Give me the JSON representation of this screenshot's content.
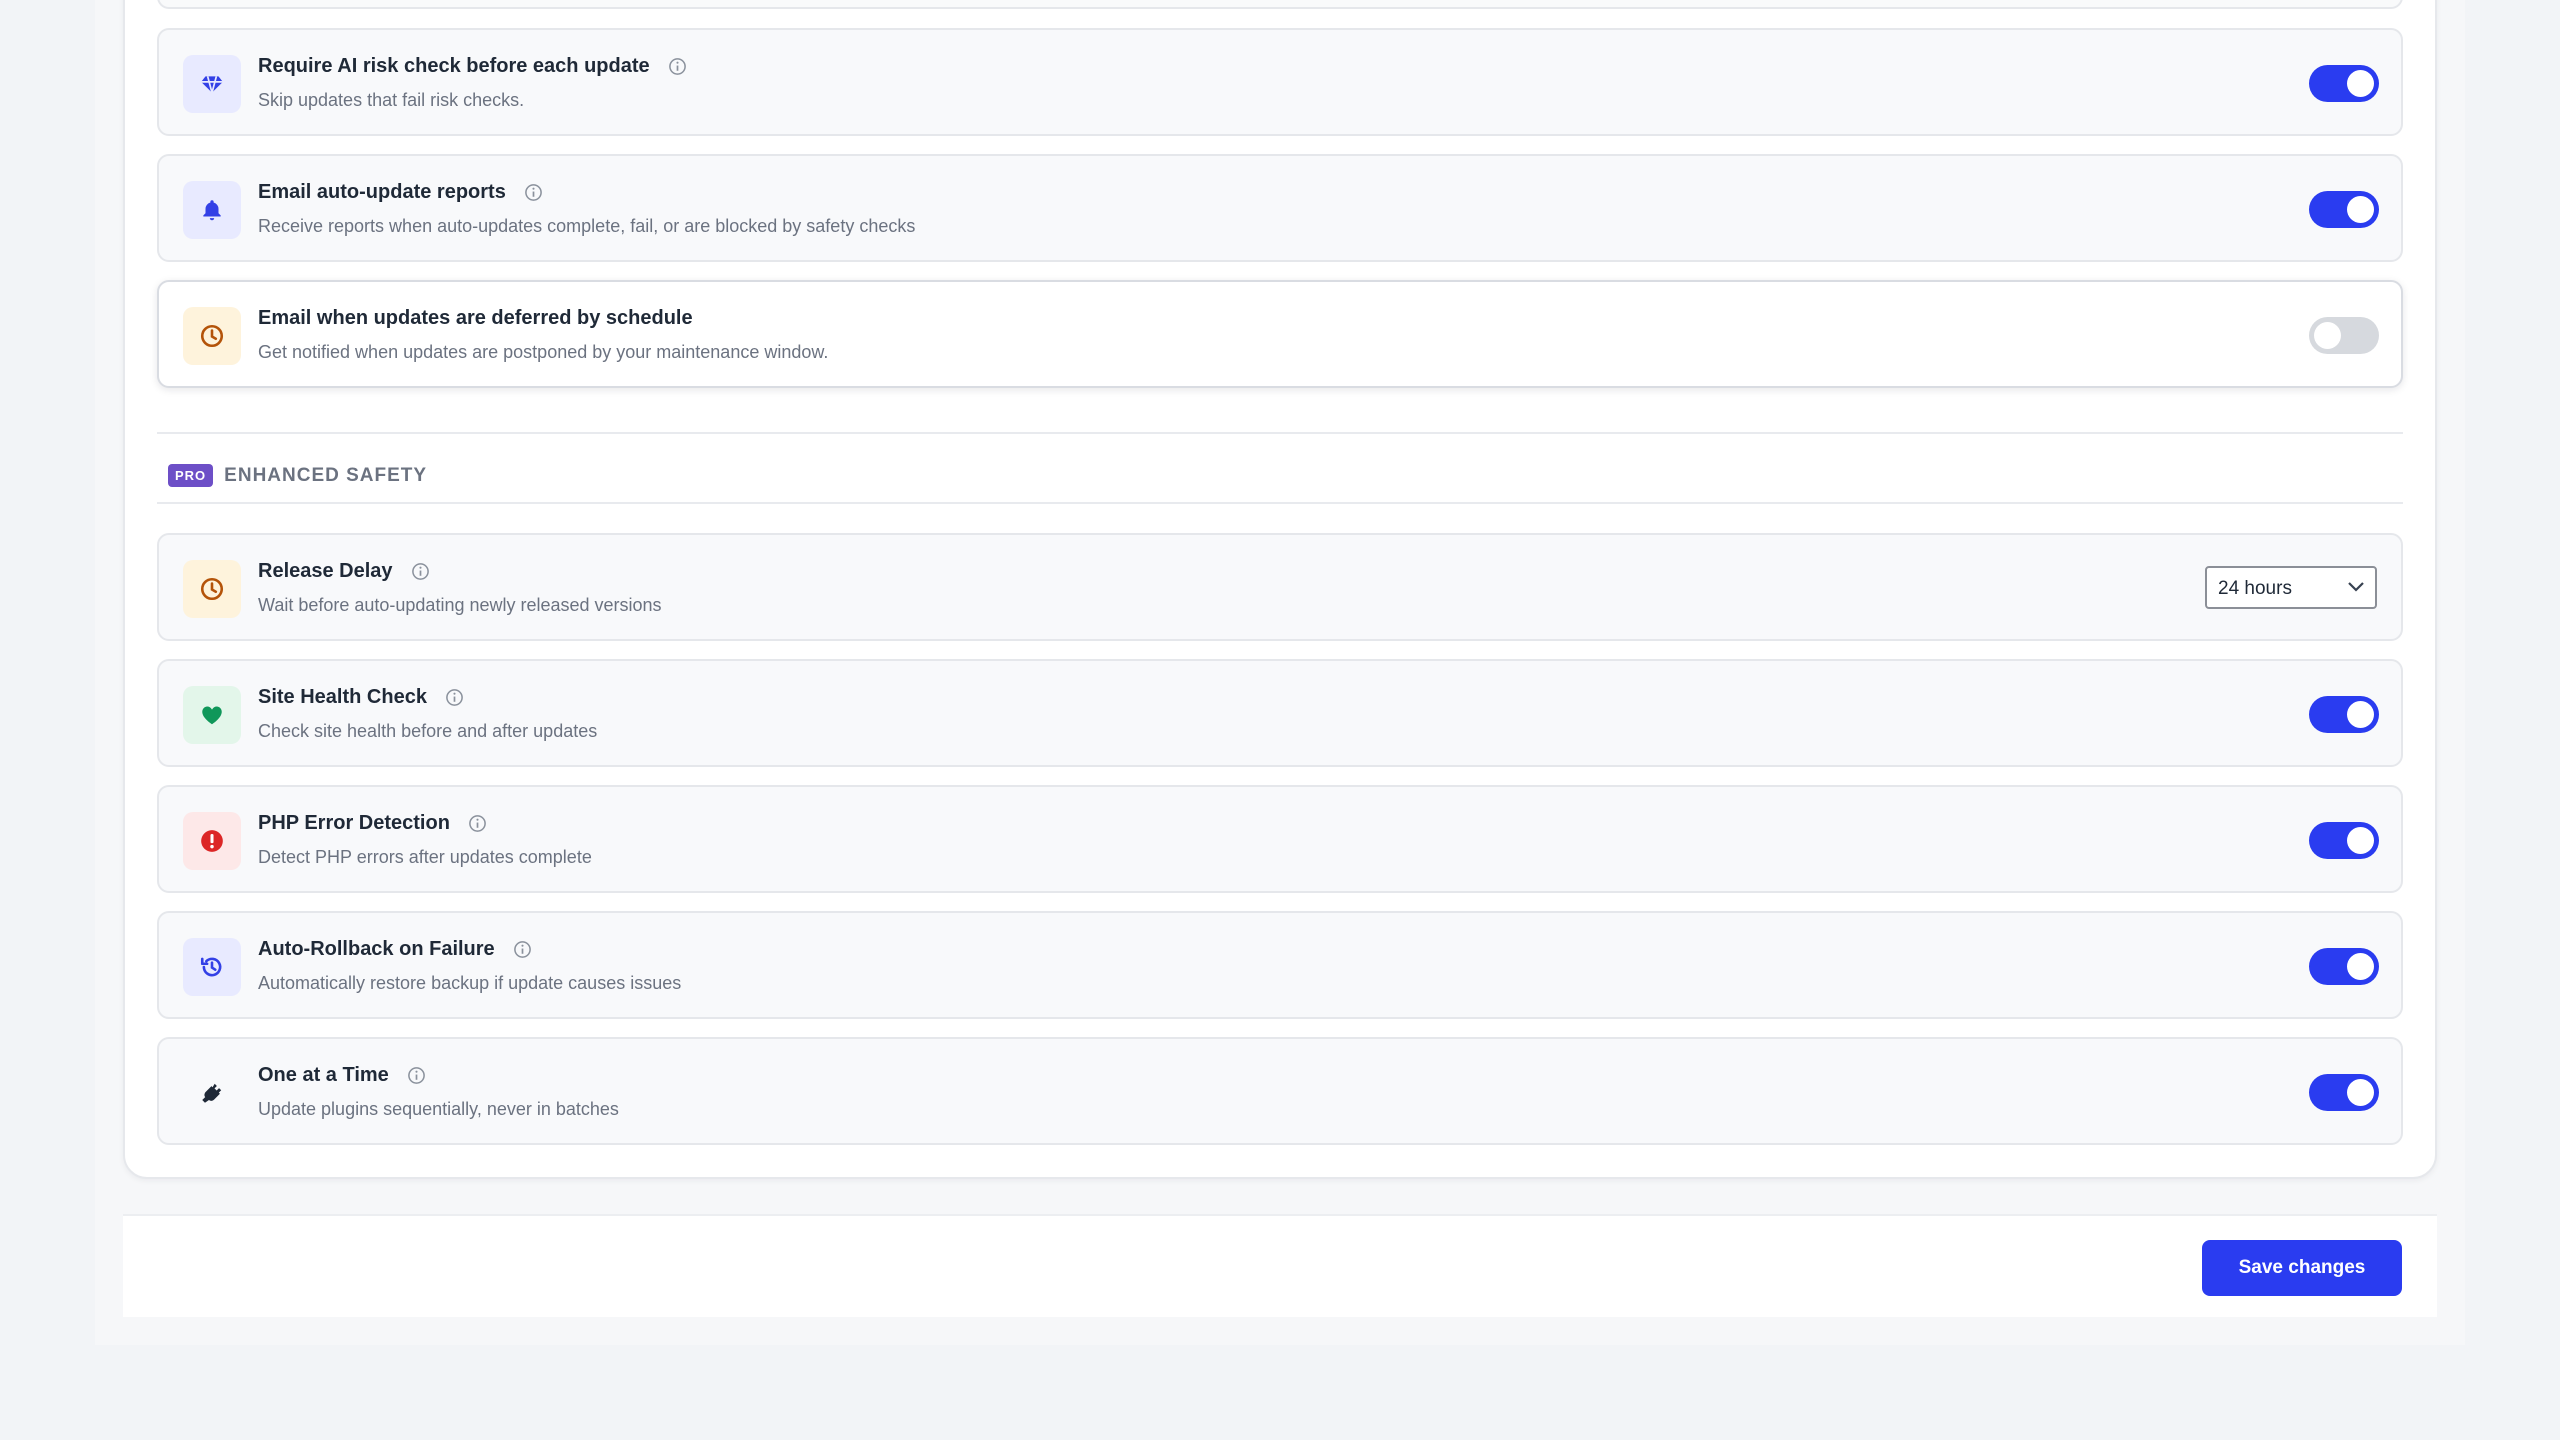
{
  "settings_rows": [
    {
      "title": "Require AI risk check before each update",
      "desc": "Skip updates that fail risk checks.",
      "enabled": true,
      "icon": "diamond-icon"
    },
    {
      "title": "Email auto-update reports",
      "desc": "Receive reports when auto-updates complete, fail, or are blocked by safety checks",
      "enabled": true,
      "icon": "bell-icon"
    },
    {
      "title": "Email when updates are deferred by schedule",
      "desc": "Get notified when updates are postponed by your maintenance window.",
      "enabled": false,
      "icon": "clock-icon"
    }
  ],
  "enhanced_safety": {
    "badge": "PRO",
    "title": "ENHANCED SAFETY",
    "rows": [
      {
        "title": "Release Delay",
        "desc": "Wait before auto-updating newly released versions",
        "control": "select",
        "value": "24 hours",
        "icon": "clock-icon"
      },
      {
        "title": "Site Health Check",
        "desc": "Check site health before and after updates",
        "enabled": true,
        "icon": "heart-icon"
      },
      {
        "title": "PHP Error Detection",
        "desc": "Detect PHP errors after updates complete",
        "enabled": true,
        "icon": "alert-circle-icon"
      },
      {
        "title": "Auto-Rollback on Failure",
        "desc": "Automatically restore backup if update causes issues",
        "enabled": true,
        "icon": "history-icon"
      },
      {
        "title": "One at a Time",
        "desc": "Update plugins sequentially, never in batches",
        "enabled": true,
        "icon": "plug-icon"
      }
    ]
  },
  "footer": {
    "save_label": "Save changes"
  },
  "colors": {
    "accent": "#2a3cf0",
    "toggle_off": "#d6d9de",
    "pro_badge": "#6d4fc7"
  }
}
